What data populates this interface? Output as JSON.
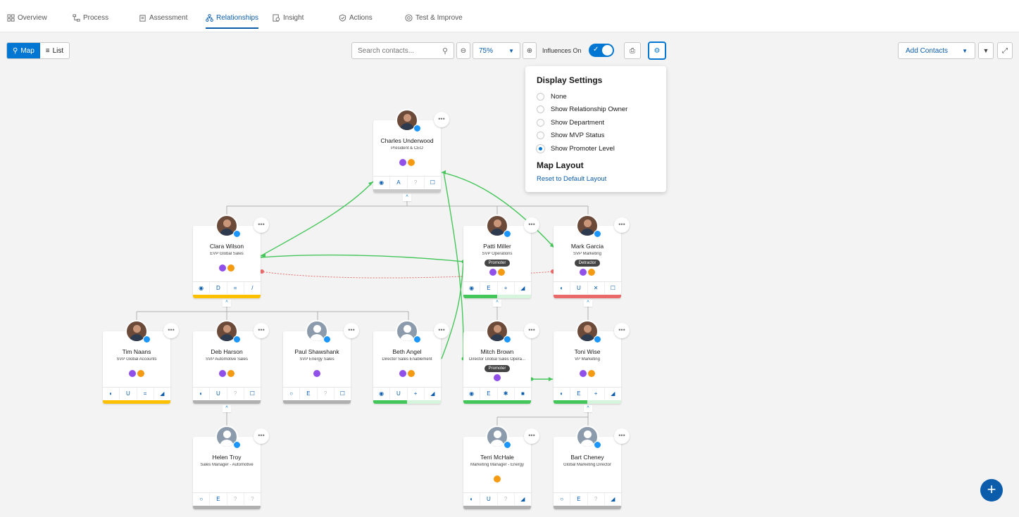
{
  "nav": {
    "tabs": [
      {
        "label": "Overview"
      },
      {
        "label": "Process"
      },
      {
        "label": "Assessment"
      },
      {
        "label": "Relationships"
      },
      {
        "label": "Insight"
      },
      {
        "label": "Actions"
      },
      {
        "label": "Test & Improve"
      }
    ],
    "active_tab": "Relationships"
  },
  "toolbar": {
    "view_map": "Map",
    "view_list": "List",
    "search_placeholder": "Search contacts...",
    "zoom": "75%",
    "influences_label": "Influences On",
    "add_contacts": "Add Contacts"
  },
  "display_settings": {
    "title": "Display Settings",
    "options": [
      "None",
      "Show Relationship Owner",
      "Show Department",
      "Show MVP Status",
      "Show Promoter Level"
    ],
    "selected": "Show Promoter Level",
    "layout_title": "Map Layout",
    "reset_link": "Reset to Default Layout"
  },
  "contacts": [
    {
      "name": "Charles Underwood",
      "title": "President & CEO",
      "photo": true,
      "tag": "",
      "dots": [
        "p",
        "o"
      ],
      "icons": [
        "◉",
        "A",
        "?",
        "☐"
      ],
      "bar": [
        "#c9c9c9"
      ]
    },
    {
      "name": "Clara Wilson",
      "title": "EVP Global Sales",
      "photo": true,
      "tag": "",
      "dots": [
        "p",
        "o"
      ],
      "icons": [
        "◉",
        "D",
        "=",
        "/"
      ],
      "bar": [
        "#fcc003"
      ]
    },
    {
      "name": "Patti Miller",
      "title": "SVP Operations",
      "photo": true,
      "tag": "Promoter",
      "dots": [
        "p",
        "o"
      ],
      "icons": [
        "◉",
        "E",
        "+",
        "◢"
      ],
      "bar": [
        "#45c65a",
        "#d6f5dc"
      ]
    },
    {
      "name": "Mark Garcia",
      "title": "SVP Marketing",
      "photo": true,
      "tag": "Detractor",
      "dots": [
        "p",
        "o"
      ],
      "icons": [
        "◐",
        "U",
        "✕",
        "☐"
      ],
      "bar": [
        "#ea6a6a"
      ]
    },
    {
      "name": "Tim Naans",
      "title": "SVP Global Accounts",
      "photo": true,
      "tag": "",
      "dots": [
        "p",
        "o"
      ],
      "icons": [
        "◐",
        "U",
        "=",
        "◢"
      ],
      "bar": [
        "#fcc003"
      ]
    },
    {
      "name": "Deb Harson",
      "title": "SVP Automotive Sales",
      "photo": true,
      "tag": "",
      "dots": [
        "p",
        "o"
      ],
      "icons": [
        "◐",
        "U",
        "?",
        "☐"
      ],
      "bar": [
        "#b0b0b0"
      ]
    },
    {
      "name": "Paul Shawshank",
      "title": "SVP Energy Sales",
      "photo": false,
      "tag": "",
      "dots": [
        "p"
      ],
      "icons": [
        "○",
        "E",
        "?",
        "☐"
      ],
      "bar": [
        "#b0b0b0"
      ]
    },
    {
      "name": "Beth Angel",
      "title": "Director Sales Enablement",
      "photo": false,
      "tag": "",
      "dots": [
        "p",
        "o"
      ],
      "icons": [
        "◉",
        "U",
        "+",
        "◢"
      ],
      "bar": [
        "#45c65a",
        "#d6f5dc"
      ]
    },
    {
      "name": "Mitch Brown",
      "title": "Director Global Sales Opera...",
      "photo": true,
      "tag": "Promoter",
      "dots": [
        "p"
      ],
      "icons": [
        "◉",
        "E",
        "✱",
        "■"
      ],
      "bar": [
        "#45c65a"
      ]
    },
    {
      "name": "Toni Wise",
      "title": "VP Marketing",
      "photo": true,
      "tag": "",
      "dots": [
        "p",
        "o"
      ],
      "icons": [
        "◐",
        "E",
        "+",
        "◢"
      ],
      "bar": [
        "#45c65a",
        "#d6f5dc"
      ]
    },
    {
      "name": "Helen Troy",
      "title": "Sales Manager - Automotive",
      "photo": false,
      "tag": "",
      "dots": [],
      "icons": [
        "○",
        "E",
        "?",
        "?"
      ],
      "bar": [
        "#b0b0b0"
      ]
    },
    {
      "name": "Terri McHale",
      "title": "Marketing Manager - Energy",
      "photo": false,
      "tag": "",
      "dots": [
        "o"
      ],
      "icons": [
        "◐",
        "U",
        "?",
        "◢"
      ],
      "bar": [
        "#b0b0b0"
      ]
    },
    {
      "name": "Bart Cheney",
      "title": "Global Marketing Director",
      "photo": false,
      "tag": "",
      "dots": [],
      "icons": [
        "○",
        "E",
        "?",
        "◢"
      ],
      "bar": [
        "#b0b0b0"
      ]
    }
  ]
}
